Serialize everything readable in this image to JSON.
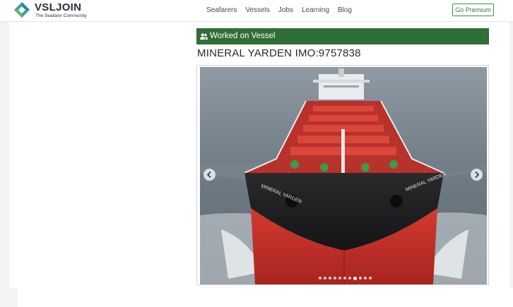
{
  "header": {
    "brand": "VSLJOIN",
    "tagline": "The Seafarer Community",
    "nav": [
      "Seafarers",
      "Vessels",
      "Jobs",
      "Learning",
      "Blog"
    ],
    "premium_label": "Go Premium"
  },
  "section": {
    "label": "Worked on Vessel"
  },
  "vessel": {
    "title": "MINERAL YARDEN IMO:9757838",
    "hull_text": "MINERAL YARDEN"
  },
  "carousel": {
    "slide_count": 11,
    "active_index": 7
  },
  "colors": {
    "accent": "#2f6e34",
    "hull_red": "#c8322c",
    "hull_black": "#1c1c1e"
  }
}
